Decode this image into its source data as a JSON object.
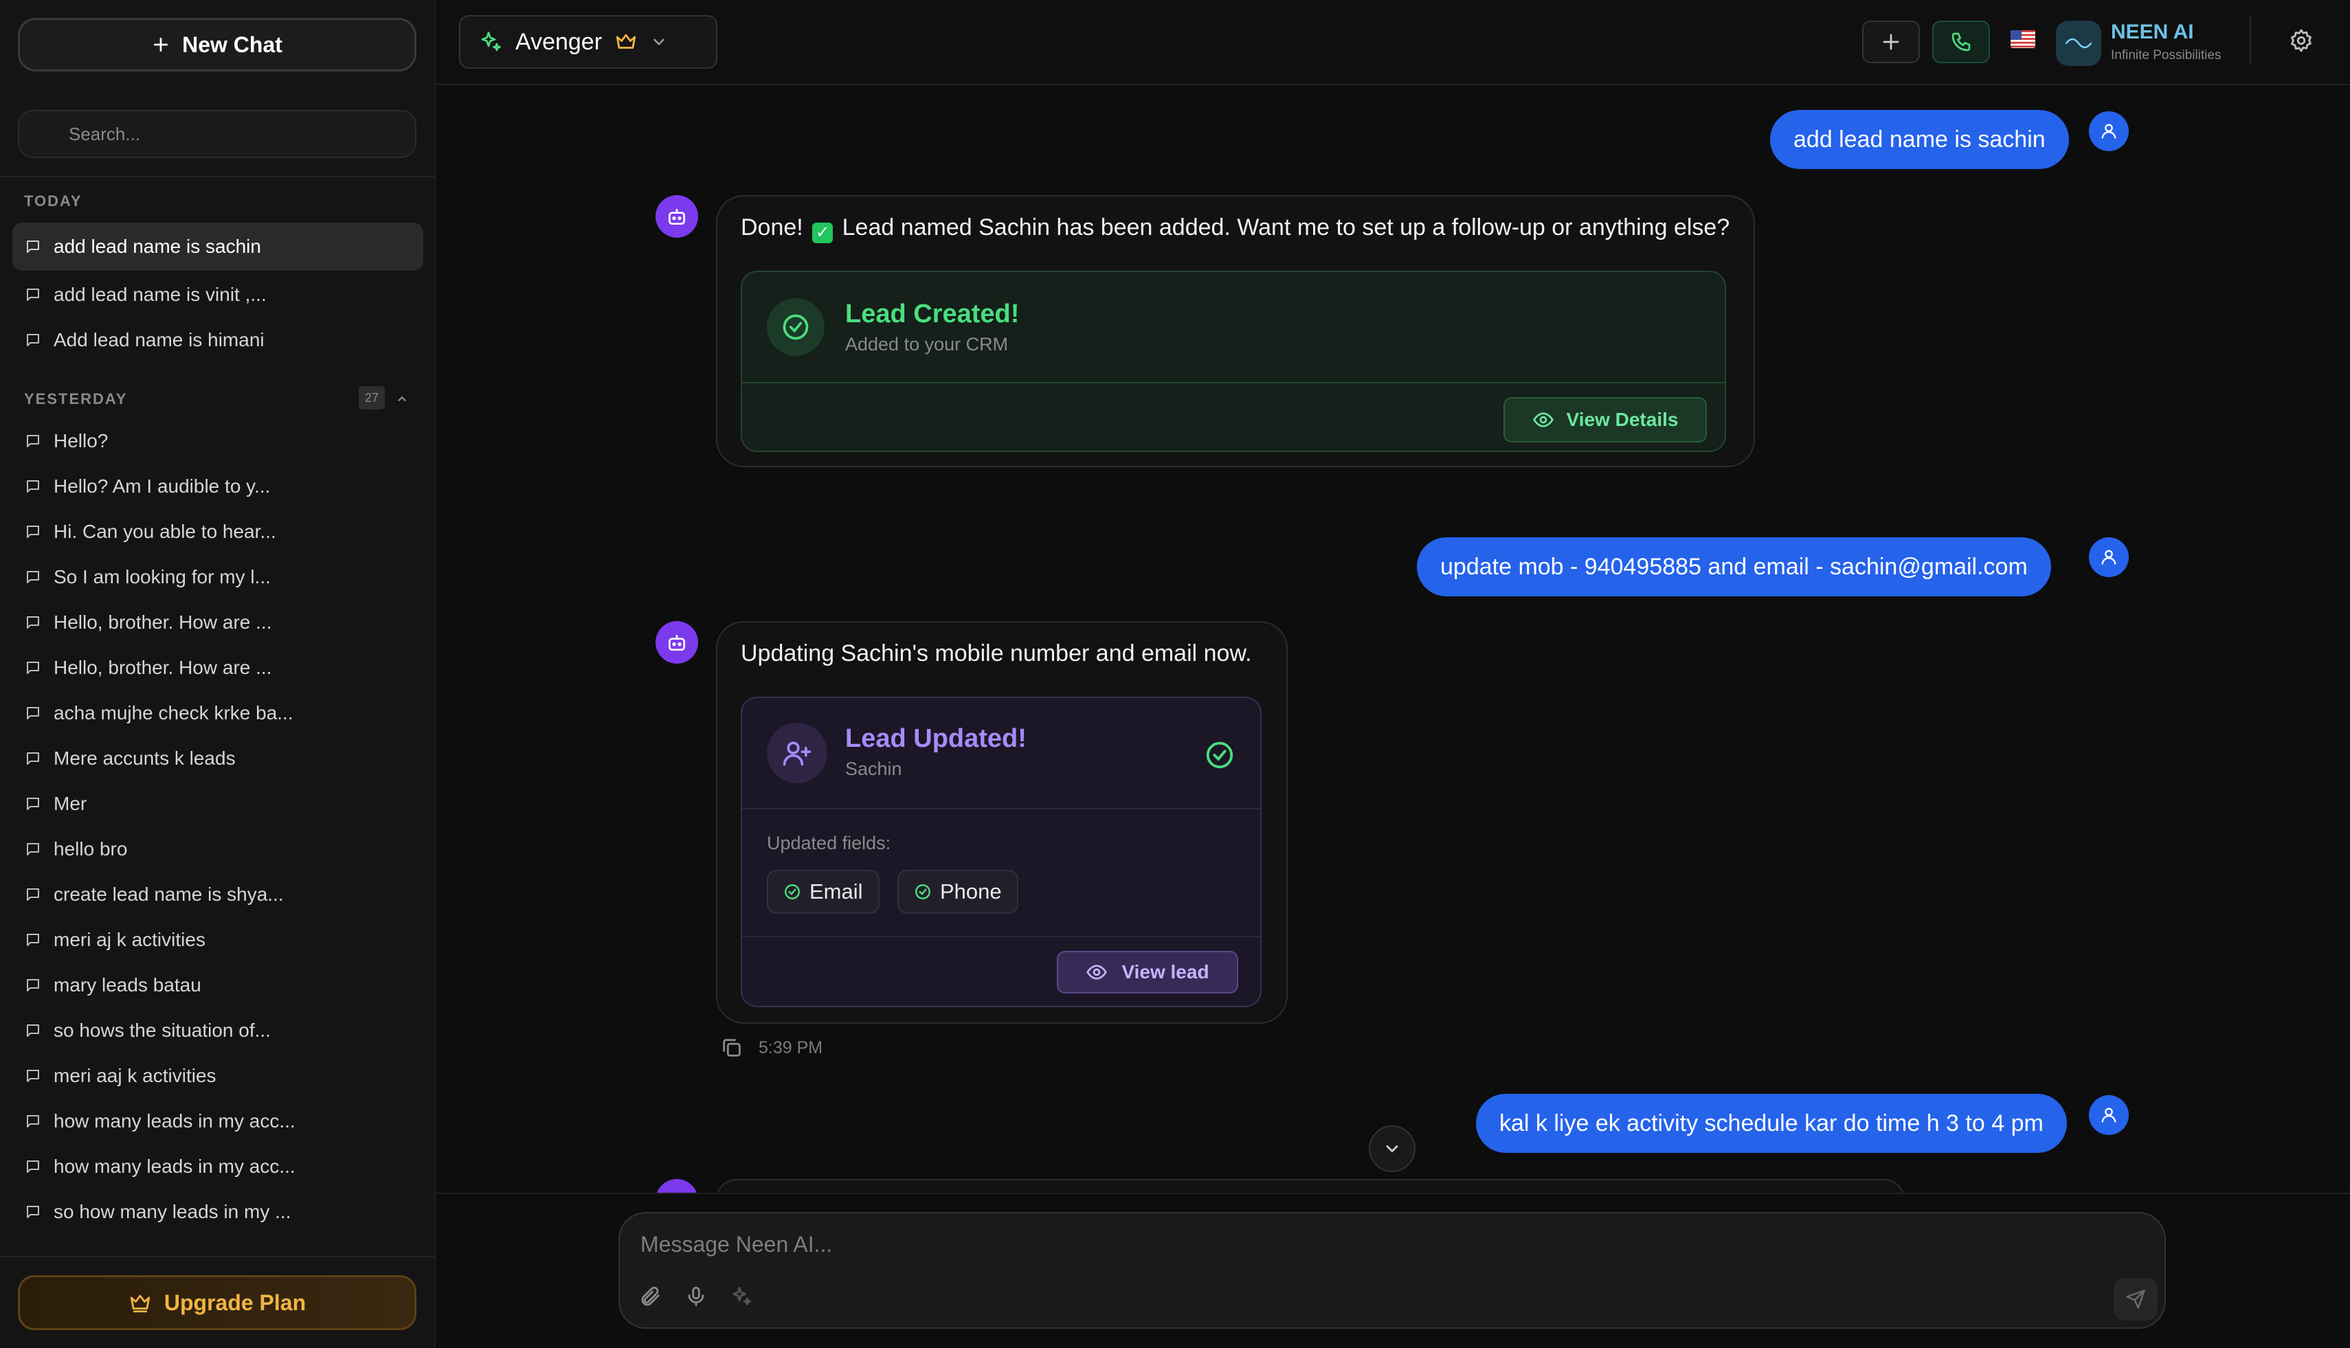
{
  "sidebar": {
    "new_chat_label": "New Chat",
    "search_placeholder": "Search...",
    "today_label": "TODAY",
    "yesterday_label": "YESTERDAY",
    "yesterday_count": "27",
    "today_items": [
      {
        "label": "add lead name is sachin"
      },
      {
        "label": "add lead name is vinit ,..."
      },
      {
        "label": "Add lead name is himani"
      }
    ],
    "yesterday_items": [
      {
        "label": "Hello?"
      },
      {
        "label": "Hello? Am I audible to y..."
      },
      {
        "label": "Hi. Can you able to hear..."
      },
      {
        "label": "So I am looking for my l..."
      },
      {
        "label": "Hello, brother. How are ..."
      },
      {
        "label": "Hello, brother. How are ..."
      },
      {
        "label": "acha mujhe check krke ba..."
      },
      {
        "label": "Mere accunts k leads"
      },
      {
        "label": "Mer"
      },
      {
        "label": "hello bro"
      },
      {
        "label": "create lead name is shya..."
      },
      {
        "label": "meri aj k activities"
      },
      {
        "label": "mary leads batau"
      },
      {
        "label": "so hows the situation of..."
      },
      {
        "label": "meri aaj k activities"
      },
      {
        "label": "how many leads in my acc..."
      },
      {
        "label": "how many leads in my acc..."
      },
      {
        "label": "so how many leads in my ..."
      }
    ],
    "upgrade_label": "Upgrade Plan"
  },
  "header": {
    "model_name": "Avenger",
    "brand_name": "NEEN AI",
    "brand_tagline": "Infinite Possibilities",
    "flag_icon": "us-flag-icon"
  },
  "chat": {
    "messages": [
      {
        "role": "user",
        "text": "add lead name is sachin"
      },
      {
        "role": "assistant",
        "text_before": "Done!",
        "text_after": "Lead named Sachin has been added. Want me to set up a follow-up or anything else?",
        "card": {
          "title": "Lead Created!",
          "subtitle": "Added to your CRM",
          "button": "View Details"
        }
      },
      {
        "role": "user",
        "text": "update mob - 940495885 and email - sachin@gmail.com"
      },
      {
        "role": "assistant",
        "text": "Updating Sachin's mobile number and email now.",
        "card": {
          "title": "Lead Updated!",
          "subtitle": "Sachin",
          "fields_label": "Updated fields:",
          "fields": [
            "Email",
            "Phone"
          ],
          "button": "View lead"
        },
        "time": "5:39 PM"
      },
      {
        "role": "user",
        "text": "kal k liye ek activity schedule kar do time h  3 to 4 pm"
      }
    ]
  },
  "composer": {
    "placeholder": "Message Neen AI..."
  },
  "colors": {
    "user_bubble": "#2563eb",
    "bot_avatar": "#7c3aed",
    "success": "#4ade80",
    "accent_purple": "#a78bfa",
    "upgrade_gold": "#f2b544"
  }
}
